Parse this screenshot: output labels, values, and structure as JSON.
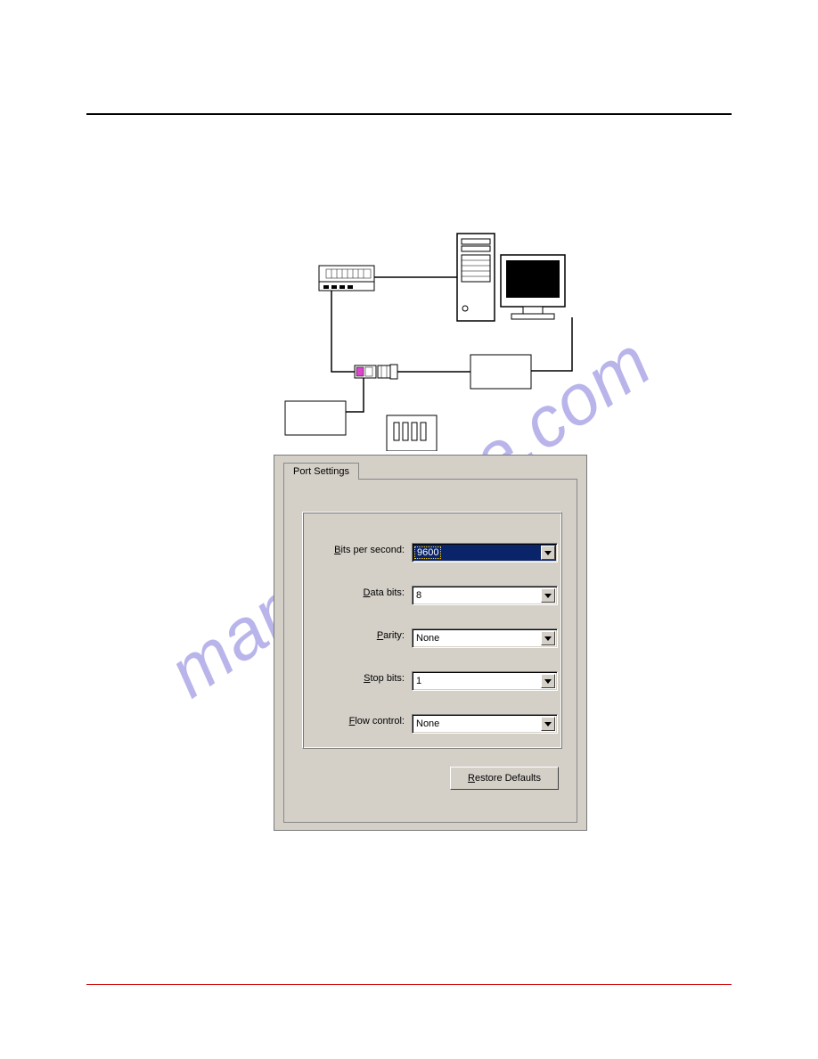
{
  "watermark": "manualshive.com",
  "dialog": {
    "tab_label": "Port Settings",
    "fields": {
      "bits_per_second": {
        "label_pre": "B",
        "label_post": "its per second:",
        "value": "9600"
      },
      "data_bits": {
        "label_pre": "D",
        "label_post": "ata bits:",
        "value": "8"
      },
      "parity": {
        "label_pre": "P",
        "label_post": "arity:",
        "value": "None"
      },
      "stop_bits": {
        "label_pre": "S",
        "label_post": "top bits:",
        "value": "1"
      },
      "flow_control": {
        "label_pre": "F",
        "label_post": "low control:",
        "value": "None"
      }
    },
    "restore_label_pre": "R",
    "restore_label_post": "estore Defaults"
  }
}
